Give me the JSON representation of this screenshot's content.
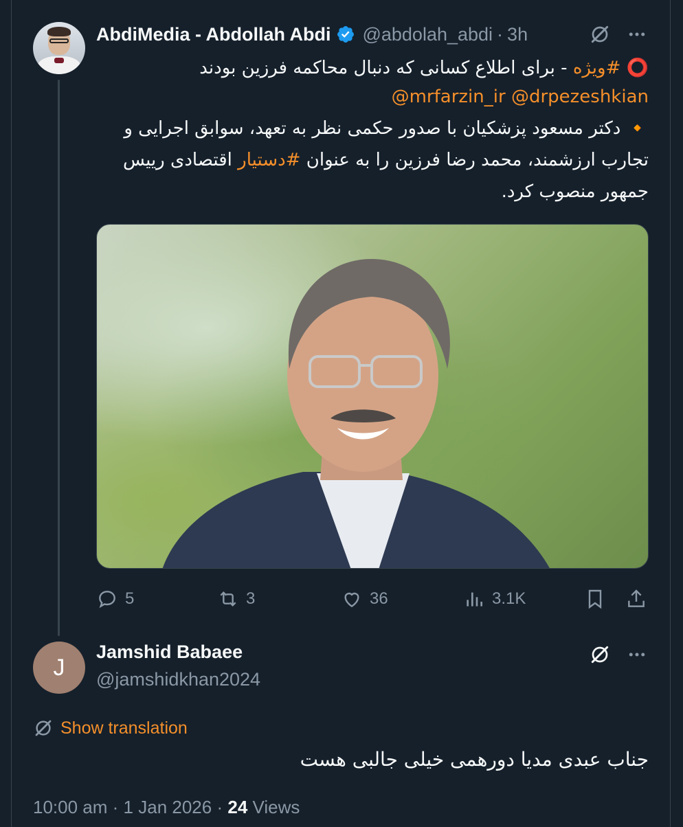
{
  "tweet": {
    "author_name": "AbdiMedia - Abdollah Abdi",
    "handle": "@abdolah_abdi",
    "separator": "·",
    "time": "3h",
    "line1_emoji": "⭕️",
    "line1_tag": "#ویژه",
    "line1_rest": " - برای اطلاع کسانی که دنبال محاکمه فرزین بودند",
    "mention_1": "@drpezeshkian",
    "mention_2": "@mrfarzin_ir",
    "line3_emoji": "🔸",
    "line3_text": "دکتر مسعود پزشکیان با صدور حکمی نظر به تعهد، سوابق اجرایی و تجارب ارزشمند، محمد رضا فرزین را به عنوان ",
    "line3_tag": "#دستیار",
    "line3_tail": " اقتصادی رییس جمهور منصوب کرد.",
    "stats": {
      "replies": "5",
      "reposts": "3",
      "likes": "36",
      "views": "3.1K"
    }
  },
  "reply": {
    "avatar_letter": "J",
    "author_name": "Jamshid Babaee",
    "handle": "@jamshidkhan2024",
    "show_translation": "Show translation",
    "text": "جناب عبدی مدیا دورهمی خیلی جالبی هست",
    "time": "10:00 am",
    "separator": "·",
    "date": "1 Jan 2026",
    "views_count": "24",
    "views_label": "Views"
  },
  "colors": {
    "background": "#15202b",
    "accent": "#f58f2a",
    "muted": "#8b98a5",
    "verified": "#1d9bf0"
  }
}
